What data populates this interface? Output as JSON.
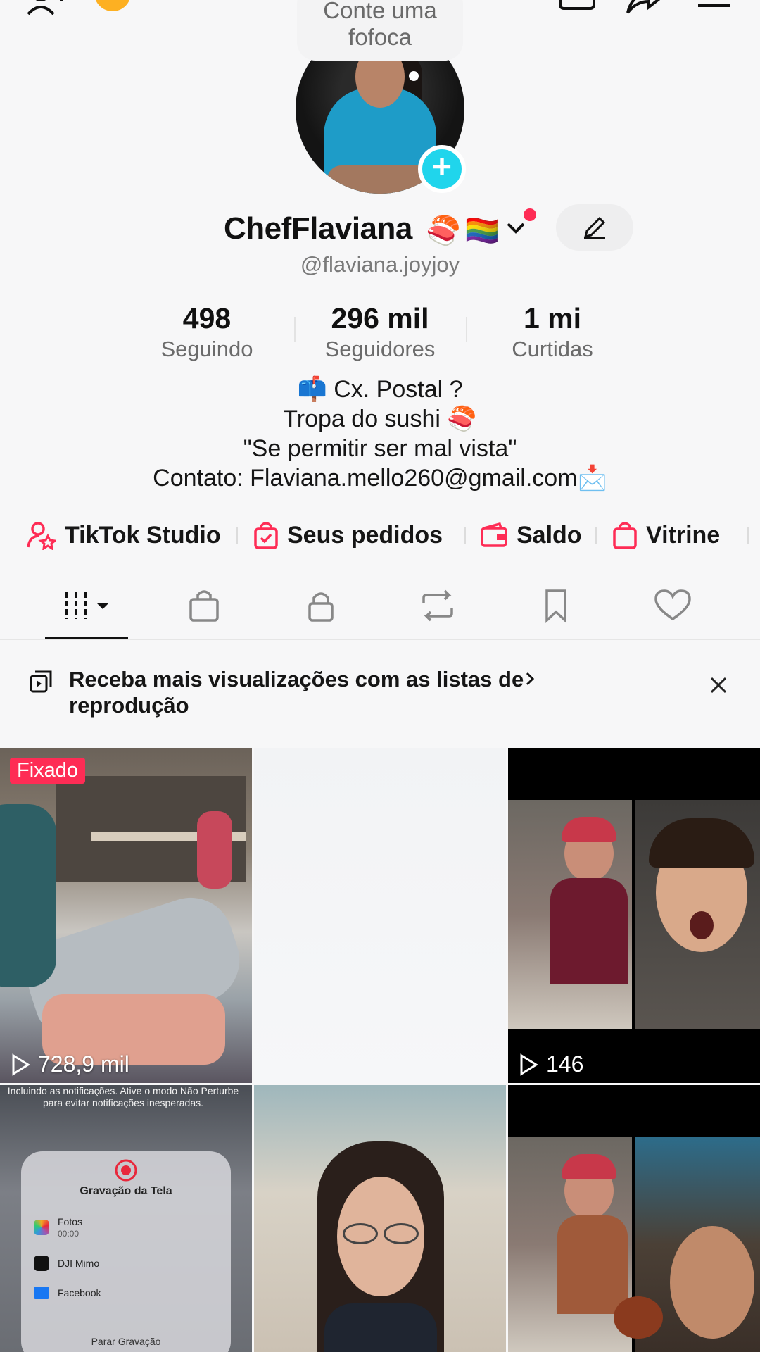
{
  "top_bubble": {
    "text": "Conte uma fofoca"
  },
  "profile": {
    "display_name": "ChefFlaviana",
    "name_emojis": [
      "🍣",
      "🏳️‍🌈"
    ],
    "username": "@flaviana.joyjoy",
    "stats": [
      {
        "value": "498",
        "label": "Seguindo"
      },
      {
        "value": "296 mil",
        "label": "Seguidores"
      },
      {
        "value": "1 mi",
        "label": "Curtidas"
      }
    ],
    "bio": [
      "📫 Cx. Postal ?",
      "Tropa do sushi 🍣",
      "\"Se permitir ser mal vista\"",
      "Contato: Flaviana.mello260@gmail.com📩"
    ]
  },
  "shortcuts": [
    {
      "label": "TikTok Studio",
      "icon": "person-star-icon"
    },
    {
      "label": "Seus pedidos",
      "icon": "order-bag-icon"
    },
    {
      "label": "Saldo",
      "icon": "wallet-icon"
    },
    {
      "label": "Vitrine",
      "icon": "shopping-bag-icon"
    }
  ],
  "tabs": [
    {
      "icon": "grid-videos-icon",
      "active": true
    },
    {
      "icon": "shop-bag-icon"
    },
    {
      "icon": "lock-icon"
    },
    {
      "icon": "repost-icon"
    },
    {
      "icon": "bookmark-icon"
    },
    {
      "icon": "heart-icon"
    }
  ],
  "banner": {
    "text": "Receba mais visualizações com as listas de reprodução"
  },
  "videos": [
    {
      "pinned_label": "Fixado",
      "views": "728,9 mil"
    },
    {
      "views": ""
    },
    {
      "views": "146"
    },
    {
      "overlay_text": "Incluindo as notificações. Ative o modo Não Perturbe para evitar notificações inesperadas.",
      "sheet_title": "Gravação da Tela",
      "sheet_items": [
        {
          "name": "Fotos",
          "sub": "00:00"
        },
        {
          "name": "DJI Mimo"
        },
        {
          "name": "Facebook"
        }
      ],
      "sheet_stop": "Parar Gravação"
    },
    {
      "views": ""
    },
    {
      "views": ""
    }
  ],
  "colors": {
    "accent": "#fe2c55",
    "badge": "#20d5ec",
    "text": "#161616",
    "muted": "#6b6b6b"
  }
}
